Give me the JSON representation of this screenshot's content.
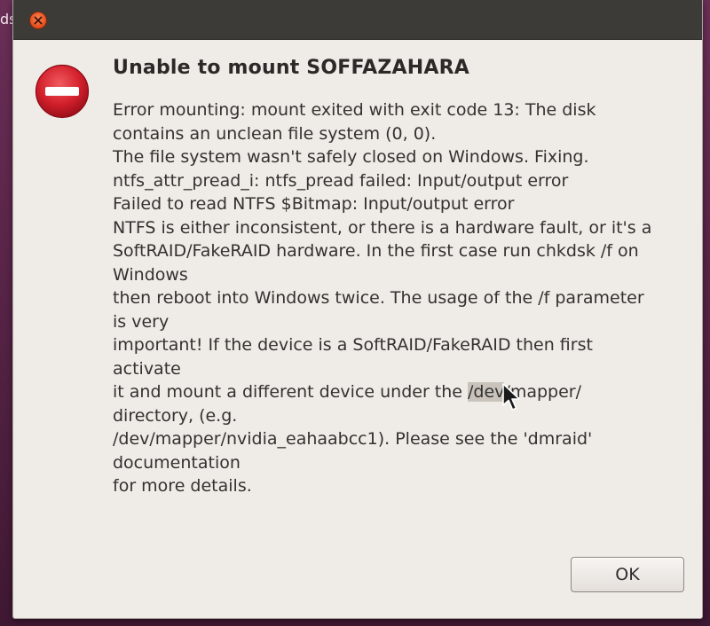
{
  "background": {
    "edge_text": "ds"
  },
  "dialog": {
    "heading": "Unable to mount SOFFAZAHARA",
    "message_lines": [
      "Error mounting: mount exited with exit code 13: The disk",
      "contains an unclean file system (0, 0).",
      "The file system wasn't safely closed on Windows. Fixing.",
      "ntfs_attr_pread_i: ntfs_pread failed: Input/output error",
      "Failed to read NTFS $Bitmap: Input/output error",
      "NTFS is either inconsistent, or there is a hardware fault, or it's a",
      "SoftRAID/FakeRAID hardware. In the first case run chkdsk /f on",
      "Windows",
      "then reboot into Windows twice. The usage of the /f parameter",
      "is very",
      "important! If the device is a SoftRAID/FakeRAID then first",
      "activate",
      {
        "before": "it and mount a different device under the ",
        "selected": "/dev",
        "after": "/mapper/"
      },
      "directory, (e.g.",
      "/dev/mapper/nvidia_eahaabcc1). Please see the 'dmraid'",
      "documentation",
      "for more details."
    ],
    "ok_label": "OK"
  },
  "icons": {
    "close": "close-icon",
    "error": "error-icon",
    "cursor": "mouse-pointer-icon"
  },
  "colors": {
    "titlebar": "#3c3b37",
    "dialog_bg": "#efebe7",
    "close_button": "#e9541f",
    "error_red": "#d3202c",
    "desktop": "#5a2549"
  }
}
